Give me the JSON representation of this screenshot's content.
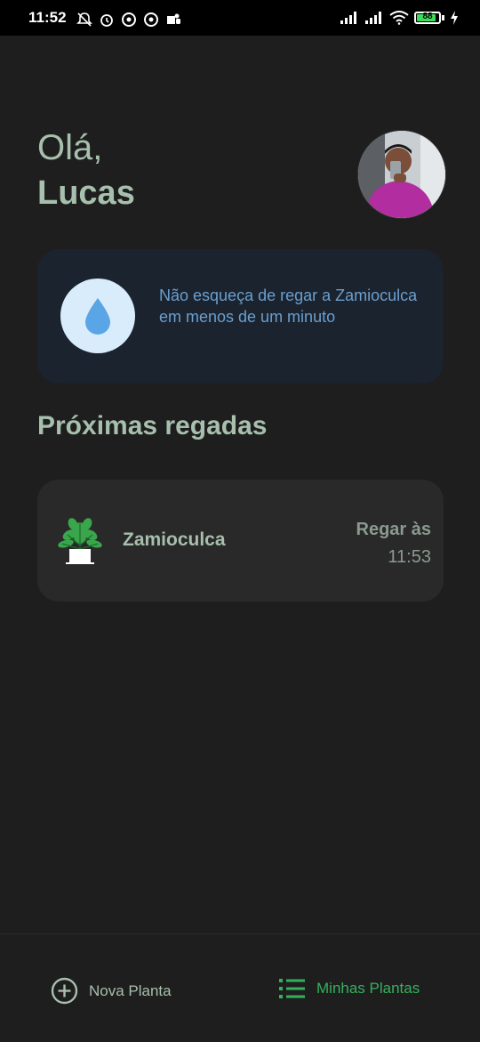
{
  "status_bar": {
    "time": "11:52",
    "battery_level": "88",
    "battery_percent": 88,
    "icons_left": [
      "mute-notifications-icon",
      "alarm-icon",
      "vpn-icon",
      "vpn-icon",
      "teams-icon"
    ],
    "icons_right": [
      "signal-icon",
      "signal-icon",
      "wifi-icon",
      "battery-icon",
      "charging-icon"
    ]
  },
  "greeting": {
    "hello": "Olá,",
    "name": "Lucas"
  },
  "reminder": {
    "icon": "water-drop-icon",
    "text": "Não esqueça de regar a Zamioculca em menos de um minuto"
  },
  "section": {
    "title": "Próximas regadas"
  },
  "plants": [
    {
      "name": "Zamioculca",
      "water_label": "Regar às",
      "water_time": "11:53"
    }
  ],
  "nav": {
    "new_plant": "Nova Planta",
    "my_plants": "Minhas Plantas",
    "active": "my_plants"
  },
  "colors": {
    "background": "#1e1e1e",
    "accent_text": "#a7bfad",
    "reminder_bg": "#1b232e",
    "reminder_text": "#6a9fcf",
    "card_bg": "#292929",
    "active_nav": "#35b05d"
  }
}
